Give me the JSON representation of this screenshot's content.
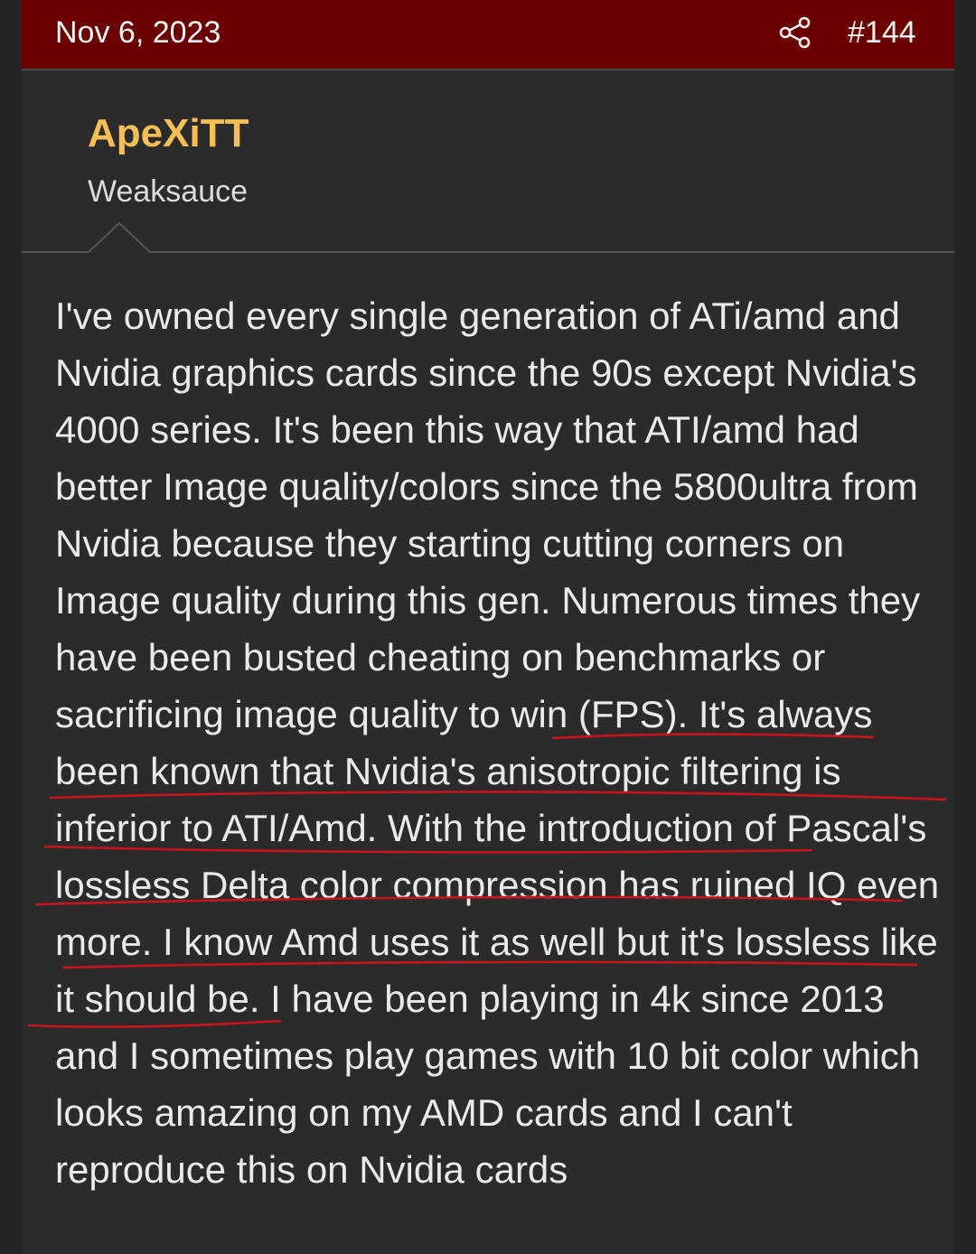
{
  "post": {
    "date": "Nov 6, 2023",
    "number": "#144",
    "share_icon": "share-icon"
  },
  "author": {
    "username": "ApeXiTT",
    "title": "Weaksauce"
  },
  "colors": {
    "header_bg": "#6b0000",
    "username": "#f5bf55",
    "page_bg": "#2b2b2b",
    "body_text": "#eaeaea",
    "annotation_underline": "#c8141e"
  },
  "body": {
    "text": "I've owned every single generation of ATi/amd and Nvidia graphics cards since the 90s except Nvidia's 4000 series. It's been this way that ATI/amd had better Image quality/colors since the 5800ultra from Nvidia because they starting cutting corners on Image quality during this gen. Numerous times they have been busted cheating on benchmarks or sacrificing image quality to win (FPS). It's always been known that Nvidia's anisotropic filtering is inferior to ATI/Amd. With the introduction of Pascal's lossless Delta color compression has ruined IQ even more. I know Amd uses it as well but it's lossless like it should be. I have been playing in 4k since 2013 and I sometimes play games with 10 bit color which looks amazing on my AMD cards and I can't reproduce this on Nvidia cards"
  }
}
